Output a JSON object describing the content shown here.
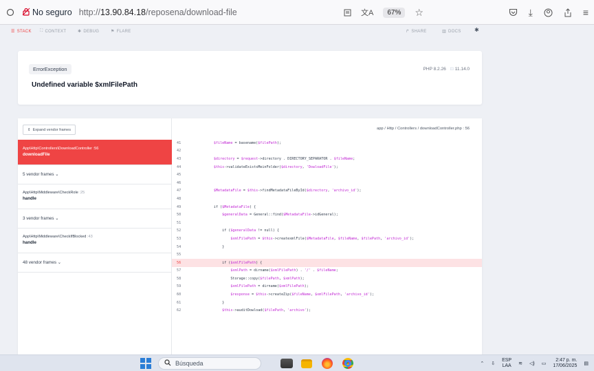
{
  "browser": {
    "security_label": "No seguro",
    "url_prefix": "http://",
    "url_host": "13.90.84.18",
    "url_path": "/reposena/download-file",
    "zoom": "67%"
  },
  "toolbar": {
    "stack": "Stack",
    "context": "Context",
    "debug": "Debug",
    "flare": "Flare",
    "share": "Share",
    "docs": "Docs"
  },
  "error": {
    "class": "ErrorException",
    "message": "Undefined variable $xmlFilePath",
    "php_version": "PHP 8.2.26",
    "laravel_version": "11.14.0"
  },
  "frames": {
    "expand_label": "Expand vendor frames",
    "items": [
      {
        "class": "App\\Http\\Controllers\\DownloadController",
        "line": ":56",
        "method": "downloadFile"
      },
      {
        "vendor": "5 vendor frames"
      },
      {
        "class": "App\\Http\\Middleware\\CheckRole",
        "line": ":25",
        "method": "handle"
      },
      {
        "vendor": "3 vendor frames"
      },
      {
        "class": "App\\Http\\Middleware\\CheckIfBlocked",
        "line": ":43",
        "method": "handle"
      },
      {
        "vendor": "48 vendor frames"
      }
    ]
  },
  "code": {
    "file_path": "app / Http / Controllers / downloadController.php : 56",
    "highlight_line": 56,
    "lines": [
      {
        "n": "41",
        "t": "            $fileName = basename($filePath);"
      },
      {
        "n": "42",
        "t": ""
      },
      {
        "n": "43",
        "t": "            $directory = $request->directory . DIRECTORY_SEPARATOR . $fileName;"
      },
      {
        "n": "44",
        "t": "            $this->validateExistsMeinFolder($directory, 'DowloadFile');"
      },
      {
        "n": "45",
        "t": ""
      },
      {
        "n": "46",
        "t": ""
      },
      {
        "n": "47",
        "t": "            $MetadataFile = $this->findMetadataFileById($directory, 'archivo_id');"
      },
      {
        "n": "48",
        "t": ""
      },
      {
        "n": "49",
        "t": "            if ($MetadataFile) {"
      },
      {
        "n": "50",
        "t": "                $generalData = General::find($MetadataFile->idGeneral);"
      },
      {
        "n": "51",
        "t": ""
      },
      {
        "n": "52",
        "t": "                if ($generalData != null) {"
      },
      {
        "n": "53",
        "t": "                    $xmlFilePath = $this->createxmlFile($MetadataFile, $fileName, $filePath, 'archivo_id');"
      },
      {
        "n": "54",
        "t": "                }"
      },
      {
        "n": "55",
        "t": ""
      },
      {
        "n": "56",
        "t": "                if ($xmlFilePath) {"
      },
      {
        "n": "57",
        "t": "                    $xmlPath = dirname($xmlFilePath) . '/' . $fileName;"
      },
      {
        "n": "58",
        "t": "                    Storage::copy($filePath, $xmlPath);"
      },
      {
        "n": "59",
        "t": "                    $xmlFilePath = dirname($xmlFilePath);"
      },
      {
        "n": "60",
        "t": "                    $response = $this->createZip($fileName, $xmlFilePath, 'archivo_id');"
      },
      {
        "n": "61",
        "t": "                }"
      },
      {
        "n": "62",
        "t": "                $this->auditDowload($filePath, 'archivo');"
      }
    ]
  },
  "taskbar": {
    "search_placeholder": "Búsqueda",
    "lang": "ESP",
    "lang_sub": "LAA",
    "time": "2:47 p. m.",
    "date": "17/06/2025"
  },
  "colors": {
    "accent": "#ef4444",
    "highlight_bg": "#fde2e4",
    "variable": "#c026d3",
    "string": "#c026d3"
  }
}
